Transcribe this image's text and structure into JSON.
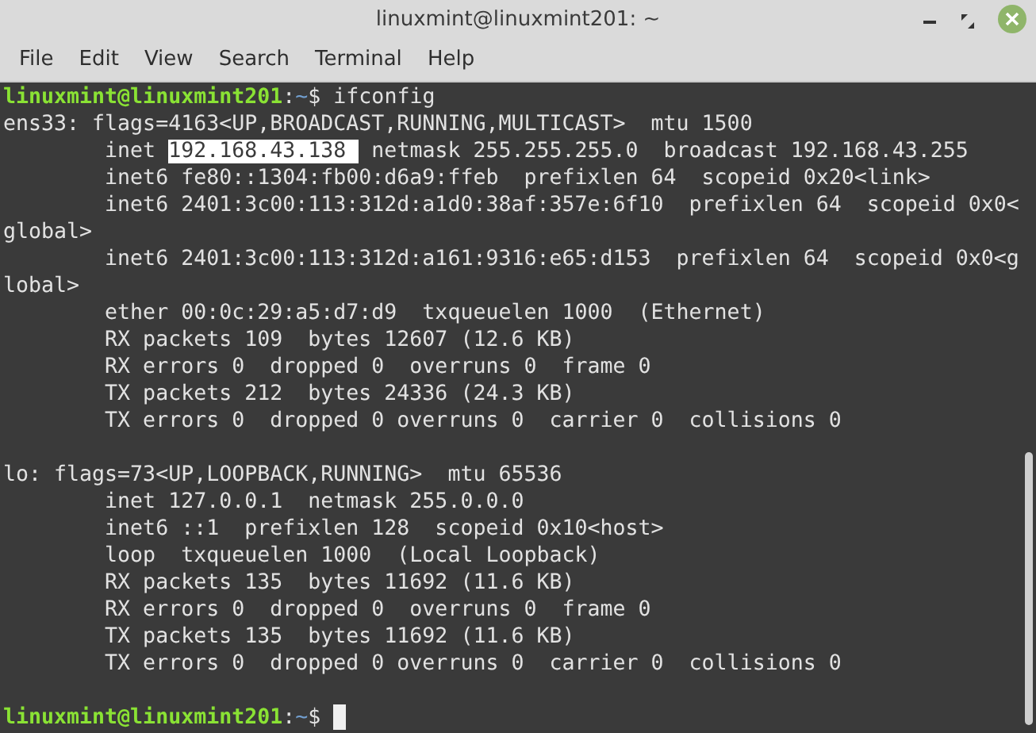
{
  "window": {
    "title": "linuxmint@linuxmint201: ~"
  },
  "menu": [
    "File",
    "Edit",
    "View",
    "Search",
    "Terminal",
    "Help"
  ],
  "terminal": {
    "lines": [
      {
        "segments": [
          {
            "kind": "user",
            "text": "linuxmint@linuxmint201"
          },
          {
            "kind": "plain",
            "text": ":"
          },
          {
            "kind": "path",
            "text": "~"
          },
          {
            "kind": "plain",
            "text": "$ ifconfig"
          }
        ]
      },
      {
        "segments": [
          {
            "kind": "plain",
            "text": "ens33: flags=4163<UP,BROADCAST,RUNNING,MULTICAST>  mtu 1500"
          }
        ]
      },
      {
        "segments": [
          {
            "kind": "plain",
            "text": "        inet "
          },
          {
            "kind": "selected",
            "text": "192.168.43.138 "
          },
          {
            "kind": "plain",
            "text": " netmask 255.255.255.0  broadcast 192.168.43.255"
          }
        ]
      },
      {
        "segments": [
          {
            "kind": "plain",
            "text": "        inet6 fe80::1304:fb00:d6a9:ffeb  prefixlen 64  scopeid 0x20<link>"
          }
        ]
      },
      {
        "segments": [
          {
            "kind": "plain",
            "text": "        inet6 2401:3c00:113:312d:a1d0:38af:357e:6f10  prefixlen 64  scopeid 0x0<"
          }
        ]
      },
      {
        "segments": [
          {
            "kind": "plain",
            "text": "global>"
          }
        ]
      },
      {
        "segments": [
          {
            "kind": "plain",
            "text": "        inet6 2401:3c00:113:312d:a161:9316:e65:d153  prefixlen 64  scopeid 0x0<g"
          }
        ]
      },
      {
        "segments": [
          {
            "kind": "plain",
            "text": "lobal>"
          }
        ]
      },
      {
        "segments": [
          {
            "kind": "plain",
            "text": "        ether 00:0c:29:a5:d7:d9  txqueuelen 1000  (Ethernet)"
          }
        ]
      },
      {
        "segments": [
          {
            "kind": "plain",
            "text": "        RX packets 109  bytes 12607 (12.6 KB)"
          }
        ]
      },
      {
        "segments": [
          {
            "kind": "plain",
            "text": "        RX errors 0  dropped 0  overruns 0  frame 0"
          }
        ]
      },
      {
        "segments": [
          {
            "kind": "plain",
            "text": "        TX packets 212  bytes 24336 (24.3 KB)"
          }
        ]
      },
      {
        "segments": [
          {
            "kind": "plain",
            "text": "        TX errors 0  dropped 0 overruns 0  carrier 0  collisions 0"
          }
        ]
      },
      {
        "blank_line_before": true,
        "segments": [
          {
            "kind": "plain",
            "text": "lo: flags=73<UP,LOOPBACK,RUNNING>  mtu 65536"
          }
        ]
      },
      {
        "segments": [
          {
            "kind": "plain",
            "text": "        inet 127.0.0.1  netmask 255.0.0.0"
          }
        ]
      },
      {
        "segments": [
          {
            "kind": "plain",
            "text": "        inet6 ::1  prefixlen 128  scopeid 0x10<host>"
          }
        ]
      },
      {
        "segments": [
          {
            "kind": "plain",
            "text": "        loop  txqueuelen 1000  (Local Loopback)"
          }
        ]
      },
      {
        "segments": [
          {
            "kind": "plain",
            "text": "        RX packets 135  bytes 11692 (11.6 KB)"
          }
        ]
      },
      {
        "segments": [
          {
            "kind": "plain",
            "text": "        RX errors 0  dropped 0  overruns 0  frame 0"
          }
        ]
      },
      {
        "segments": [
          {
            "kind": "plain",
            "text": "        TX packets 135  bytes 11692 (11.6 KB)"
          }
        ]
      },
      {
        "segments": [
          {
            "kind": "plain",
            "text": "        TX errors 0  dropped 0 overruns 0  carrier 0  collisions 0"
          }
        ]
      },
      {
        "blank_line_before": true,
        "segments": [
          {
            "kind": "user",
            "text": "linuxmint@linuxmint201"
          },
          {
            "kind": "plain",
            "text": ":"
          },
          {
            "kind": "path",
            "text": "~"
          },
          {
            "kind": "plain",
            "text": "$ "
          }
        ],
        "cursor": true
      }
    ]
  }
}
